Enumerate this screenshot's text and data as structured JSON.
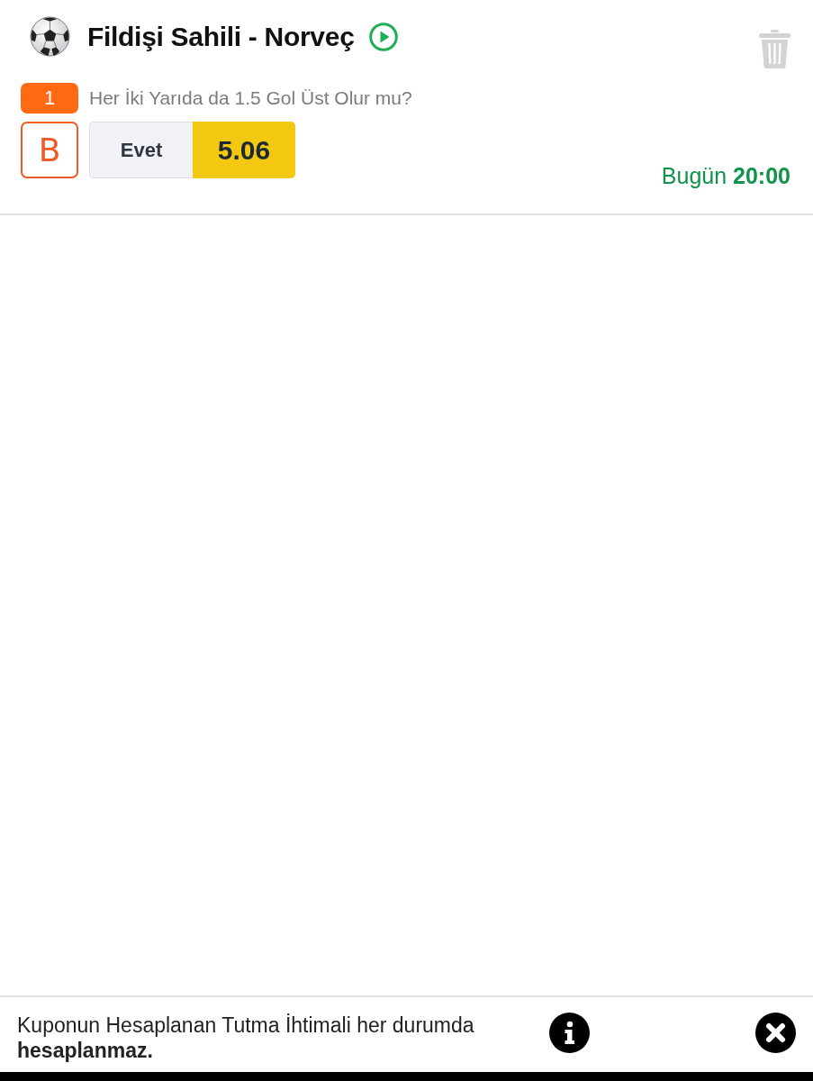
{
  "match": {
    "title": "Fildişi Sahili - Norveç"
  },
  "selection": {
    "number": "1",
    "market": "Her İki Yarıda da 1.5 Gol Üst Olur mu?",
    "bet_letter": "B",
    "outcome": "Evet",
    "odds": "5.06",
    "kickoff": "Bugün **20:00**"
  },
  "footer": {
    "message": "Kuponun Hesaplanan Tutma İhtimali her durumda **hesaplanmaz.**"
  }
}
